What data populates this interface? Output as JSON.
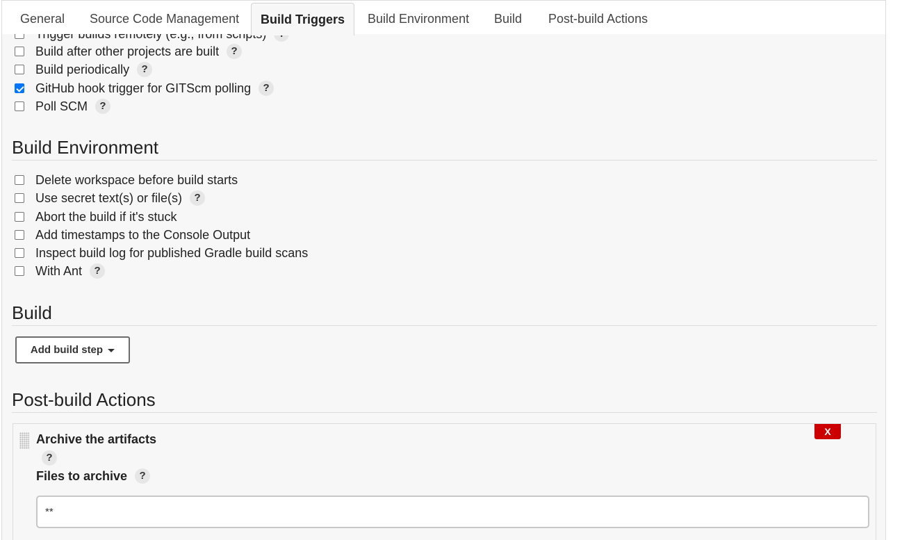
{
  "tabs": [
    {
      "label": "General"
    },
    {
      "label": "Source Code Management"
    },
    {
      "label": "Build Triggers",
      "active": true
    },
    {
      "label": "Build Environment"
    },
    {
      "label": "Build"
    },
    {
      "label": "Post-build Actions"
    }
  ],
  "build_triggers": {
    "items": [
      {
        "label": "Trigger builds remotely (e.g., from scripts)",
        "checked": false,
        "help": "?"
      },
      {
        "label": "Build after other projects are built",
        "checked": false,
        "help": "?"
      },
      {
        "label": "Build periodically",
        "checked": false,
        "help": "?"
      },
      {
        "label": "GitHub hook trigger for GITScm polling",
        "checked": true,
        "help": "?"
      },
      {
        "label": "Poll SCM",
        "checked": false,
        "help": "?"
      }
    ]
  },
  "build_environment": {
    "title": "Build Environment",
    "items": [
      {
        "label": "Delete workspace before build starts",
        "checked": false
      },
      {
        "label": "Use secret text(s) or file(s)",
        "checked": false,
        "help": "?"
      },
      {
        "label": "Abort the build if it's stuck",
        "checked": false
      },
      {
        "label": "Add timestamps to the Console Output",
        "checked": false
      },
      {
        "label": "Inspect build log for published Gradle build scans",
        "checked": false
      },
      {
        "label": "With Ant",
        "checked": false,
        "help": "?"
      }
    ]
  },
  "build": {
    "title": "Build",
    "add_step_label": "Add build step"
  },
  "post_build": {
    "title": "Post-build Actions",
    "archive": {
      "title": "Archive the artifacts",
      "delete_label": "X",
      "help": "?",
      "files_label": "Files to archive",
      "files_help": "?",
      "files_value": "**"
    }
  },
  "colors": {
    "checkbox_checked": "#0075ff",
    "delete_button": "#cc0000"
  }
}
